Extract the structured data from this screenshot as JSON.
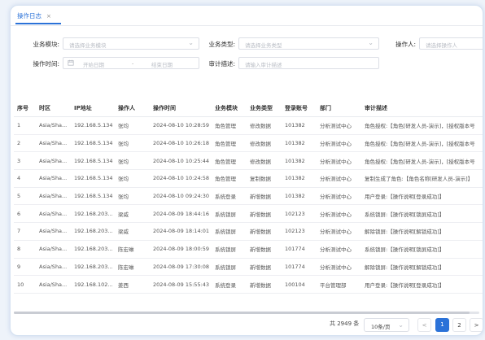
{
  "tab": {
    "label": "操作日志",
    "close": "×"
  },
  "filters": {
    "module_label": "业务模块:",
    "module_placeholder": "请选择业务模块",
    "type_label": "业务类型:",
    "type_placeholder": "请选择业务类型",
    "operator_label": "操作人:",
    "operator_placeholder": "请选择操作人",
    "time_label": "操作时间:",
    "start_placeholder": "开始日期",
    "date_sep": "-",
    "end_placeholder": "结束日期",
    "desc_label": "审计描述:",
    "desc_placeholder": "请输入审计描述"
  },
  "table": {
    "headers": [
      "序号",
      "时区",
      "IP地址",
      "操作人",
      "操作时间",
      "业务模块",
      "业务类型",
      "登录账号",
      "部门",
      "审计描述"
    ],
    "rows": [
      [
        "1",
        "Asia/Sha...",
        "192.168.5.134",
        "张均",
        "2024-08-10 10:28:59",
        "角色管理",
        "修改数据",
        "101382",
        "分析测试中心",
        "角色授权:【角色[研发人员-演示]，[授权版本号"
      ],
      [
        "2",
        "Asia/Sha...",
        "192.168.5.134",
        "张均",
        "2024-08-10 10:26:18",
        "角色管理",
        "修改数据",
        "101382",
        "分析测试中心",
        "角色授权:【角色[研发人员-演示]，[授权版本号"
      ],
      [
        "3",
        "Asia/Sha...",
        "192.168.5.134",
        "张均",
        "2024-08-10 10:25:44",
        "角色管理",
        "修改数据",
        "101382",
        "分析测试中心",
        "角色授权:【角色[研发人员-演示]，[授权版本号"
      ],
      [
        "4",
        "Asia/Sha...",
        "192.168.5.134",
        "张均",
        "2024-08-10 10:24:58",
        "角色管理",
        "复制数据",
        "101382",
        "分析测试中心",
        "复制生成了角色:【角色名称[研发人员-演示]】"
      ],
      [
        "5",
        "Asia/Sha...",
        "192.168.5.134",
        "张均",
        "2024-08-10 09:24:30",
        "系统登录",
        "新增数据",
        "101382",
        "分析测试中心",
        "用户登录:【操作说明[登录成功]】"
      ],
      [
        "6",
        "Asia/Sha...",
        "192.168.203...",
        "梁威",
        "2024-08-09 18:44:16",
        "系统锁屏",
        "新增数据",
        "102123",
        "分析测试中心",
        "系统锁屏:【操作说明[锁屏成功]】"
      ],
      [
        "7",
        "Asia/Sha...",
        "192.168.203...",
        "梁威",
        "2024-08-09 18:14:01",
        "系统锁屏",
        "新增数据",
        "102123",
        "分析测试中心",
        "解除锁屏:【操作说明[解锁成功]】"
      ],
      [
        "8",
        "Asia/Sha...",
        "192.168.203...",
        "陈宏琳",
        "2024-08-09 18:00:59",
        "系统锁屏",
        "新增数据",
        "101774",
        "分析测试中心",
        "系统锁屏:【操作说明[锁屏成功]】"
      ],
      [
        "9",
        "Asia/Sha...",
        "192.168.203...",
        "陈宏琳",
        "2024-08-09 17:30:08",
        "系统锁屏",
        "新增数据",
        "101774",
        "分析测试中心",
        "解除锁屏:【操作说明[解锁成功]】"
      ],
      [
        "10",
        "Asia/Sha...",
        "192.168.102...",
        "姜西",
        "2024-08-09 15:55:43",
        "系统登录",
        "新增数据",
        "100104",
        "平台管理部",
        "用户登录:【操作说明[登录成功]】"
      ]
    ]
  },
  "pagination": {
    "total": "共 2949 条",
    "page_size": "10条/页",
    "prev": "<",
    "pages": [
      "1",
      "2"
    ],
    "current": "1",
    "next": ">"
  },
  "colors": {
    "accent": "#2b72d8"
  },
  "icons": {
    "tab_close": "close-icon",
    "select_arrow": "chevron-down-icon",
    "date": "calendar-icon"
  }
}
